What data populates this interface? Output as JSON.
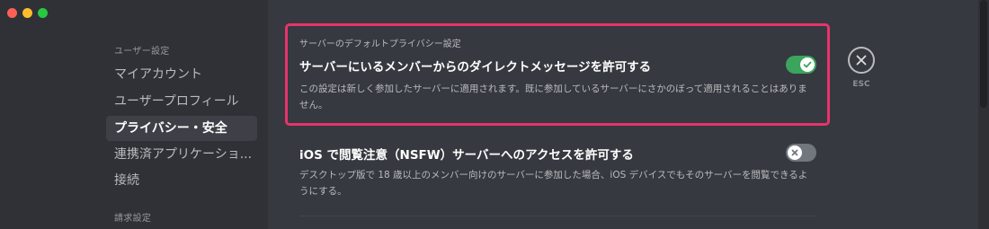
{
  "colors": {
    "sidebar_bg": "#2f3136",
    "content_bg": "#36393f",
    "highlight_border": "#e8336b",
    "toggle_on": "#3ba55d",
    "toggle_off": "#72767d"
  },
  "window_controls": [
    "close",
    "minimize",
    "zoom"
  ],
  "sidebar": {
    "section_user": "ユーザー設定",
    "items": [
      {
        "label": "マイアカウント",
        "active": false
      },
      {
        "label": "ユーザープロフィール",
        "active": false
      },
      {
        "label": "プライバシー・安全",
        "active": true
      },
      {
        "label": "連携済アプリケーショ...",
        "active": false
      },
      {
        "label": "接続",
        "active": false
      }
    ],
    "section_billing": "請求設定"
  },
  "main": {
    "section_label": "サーバーのデフォルトプライバシー設定",
    "settings": [
      {
        "title": "サーバーにいるメンバーからのダイレクトメッセージを許可する",
        "description": "この設定は新しく参加したサーバーに適用されます。既に参加しているサーバーにさかのぼって適用されることはありません。",
        "toggle": true,
        "toggle_icon": "check-icon"
      },
      {
        "title": "iOS で閲覧注意（NSFW）サーバーへのアクセスを許可する",
        "description": "デスクトップ版で 18 歳以上のメンバー向けのサーバーに参加した場合、iOS デバイスでもそのサーバーを閲覧できるようにする。",
        "toggle": false,
        "toggle_icon": "x-icon"
      }
    ]
  },
  "close": {
    "icon": "close-icon",
    "label": "ESC"
  }
}
